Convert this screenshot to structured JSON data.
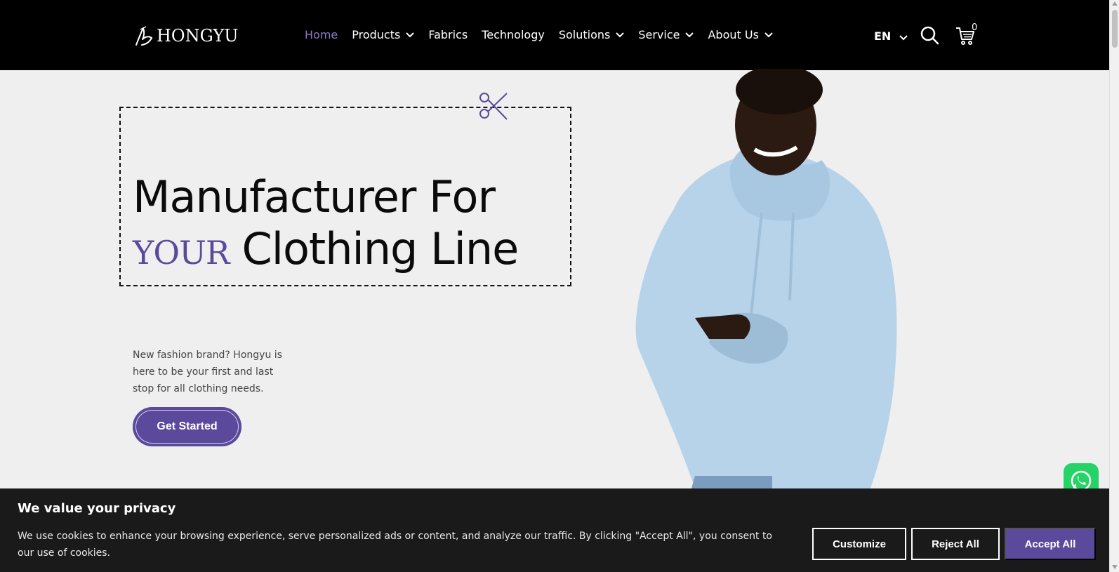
{
  "header": {
    "logo_text": "HONGYU",
    "nav": [
      {
        "label": "Home",
        "active": true,
        "dropdown": false
      },
      {
        "label": "Products",
        "active": false,
        "dropdown": true
      },
      {
        "label": "Fabrics",
        "active": false,
        "dropdown": false
      },
      {
        "label": "Technology",
        "active": false,
        "dropdown": false
      },
      {
        "label": "Solutions",
        "active": false,
        "dropdown": true
      },
      {
        "label": "Service",
        "active": false,
        "dropdown": true
      },
      {
        "label": "About Us",
        "active": false,
        "dropdown": true
      }
    ],
    "language": "EN",
    "cart_count": "0",
    "icons": {
      "search": "search-icon",
      "cart": "cart-icon"
    }
  },
  "hero": {
    "title_line1": "Manufacturer For",
    "title_accent": "YOUR",
    "title_line2": "Clothing Line",
    "description": "New fashion brand? Hongyu is here to be your first and last stop for all clothing needs.",
    "cta_label": "Get Started"
  },
  "cookie": {
    "title": "We value your privacy",
    "text": "We use cookies to enhance your browsing experience, serve personalized ads or content, and analyze our traffic. By clicking \"Accept All\", you consent to our use of cookies.",
    "customize_label": "Customize",
    "reject_label": "Reject All",
    "accept_label": "Accept All"
  },
  "colors": {
    "accent": "#5b4a9b",
    "nav_active": "#8a79c4",
    "header_bg": "#000000",
    "page_bg": "#efefef",
    "whatsapp": "#25d366"
  }
}
